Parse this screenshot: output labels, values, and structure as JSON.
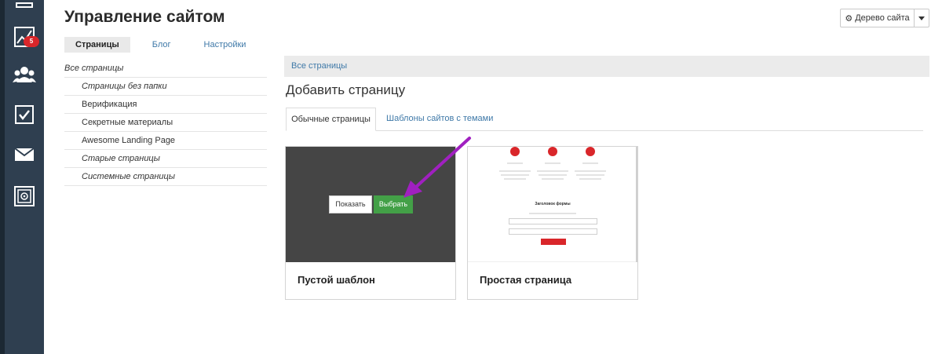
{
  "header": {
    "title": "Управление сайтом"
  },
  "site_tree_button": {
    "label": "Дерево сайта",
    "icon": "gear-icon"
  },
  "top_tabs": [
    {
      "label": "Страницы",
      "active": true
    },
    {
      "label": "Блог",
      "active": false
    },
    {
      "label": "Настройки",
      "active": false
    }
  ],
  "sidebar": {
    "items": [
      {
        "label": "Все страницы"
      },
      {
        "label": "Страницы без папки"
      },
      {
        "label": "Верификация"
      },
      {
        "label": "Секретные материалы"
      },
      {
        "label": "Awesome Landing Page"
      },
      {
        "label": "Старые страницы"
      },
      {
        "label": "Системные страницы"
      }
    ]
  },
  "nav": {
    "badge_count": "5",
    "icons": [
      "chart-icon",
      "users-icon",
      "checkbox-icon",
      "mail-icon",
      "safe-icon"
    ]
  },
  "breadcrumb": {
    "label": "Все страницы"
  },
  "main": {
    "title": "Добавить страницу",
    "tabs": [
      {
        "label": "Обычные страницы",
        "active": true
      },
      {
        "label": "Шаблоны сайтов с темами",
        "active": false
      }
    ],
    "cards": [
      {
        "caption": "Пустой шаблон",
        "show_label": "Показать",
        "select_label": "Выбрать"
      },
      {
        "caption": "Простая страница",
        "preview": {
          "form_title": "Заголовок формы"
        }
      }
    ]
  },
  "colors": {
    "accent": "#43a047",
    "badge": "#d9262a",
    "link": "#3f79a8",
    "sidebar_bg": "#2f3f50",
    "arrow": "#a020c0"
  }
}
